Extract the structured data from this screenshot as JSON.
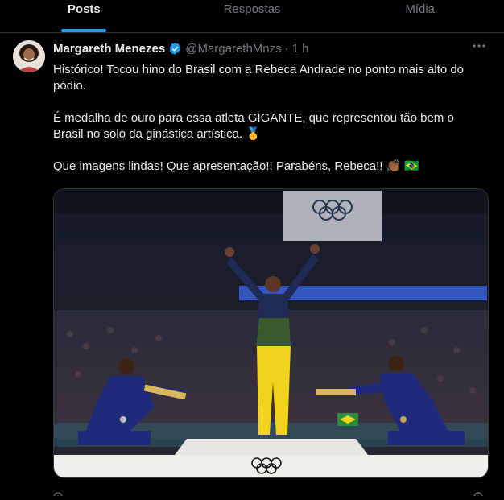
{
  "tabs": [
    {
      "label": "Posts",
      "active": true
    },
    {
      "label": "Respostas",
      "active": false
    },
    {
      "label": "Mídia",
      "active": false
    }
  ],
  "post": {
    "author_name": "Margareth Menezes",
    "handle": "@MargarethMnzs",
    "separator": "·",
    "time": "1 h",
    "more_icon": "more-icon",
    "paragraphs": [
      "Histórico! Tocou hino do Brasil com a Rebeca Andrade no ponto mais alto do pódio.",
      "É medalha de ouro para essa atleta GIGANTE, que representou tão bem o Brasil no solo da ginástica artística. 🥇",
      "Que imagens lindas! Que apresentação!! Parabéns, Rebeca!! 👏🏾 🇧🇷"
    ]
  },
  "colors": {
    "accent": "#1d9bf0",
    "text": "#e7e9ea",
    "muted": "#71767b",
    "background": "#000000"
  }
}
